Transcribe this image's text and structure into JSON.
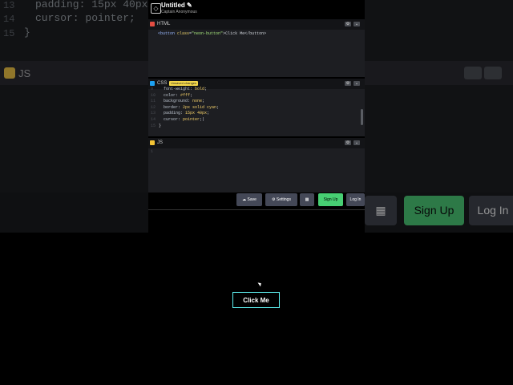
{
  "header": {
    "title": "Untitled",
    "author": "Captain Anonymous",
    "edit_icon": "pencil-icon"
  },
  "html_pane": {
    "label": "HTML",
    "badge_color": "#e44d42",
    "lines": [
      {
        "tag_open": "<button ",
        "attr": "class",
        "eq": "=",
        "str": "\"neon-button\"",
        "text": ">Click Me</button>"
      }
    ]
  },
  "css_pane": {
    "label": "CSS",
    "badge_color": "#1da1f2",
    "warning": "Unsaved changes",
    "lines": [
      {
        "num": "9",
        "prop": "font-weight",
        "val": "bold"
      },
      {
        "num": "10",
        "prop": "color",
        "val": "#fff"
      },
      {
        "num": "11",
        "prop": "background",
        "val": "none"
      },
      {
        "num": "12",
        "prop": "border",
        "val": "2px solid cyan"
      },
      {
        "num": "13",
        "prop": "padding",
        "val": "15px 40px"
      },
      {
        "num": "14",
        "prop": "cursor",
        "val": "pointer"
      },
      {
        "num": "15",
        "close": "}"
      }
    ]
  },
  "js_pane": {
    "label": "JS",
    "badge_color": "#f3c335",
    "first_line": "1"
  },
  "toolbar": {
    "save_label": "Save",
    "settings_label": "Settings",
    "layout_icon": "layout-icon",
    "signup_label": "Sign Up",
    "login_label": "Log In"
  },
  "bg": {
    "line1": "padding: 15px 40px;",
    "line2": "cursor: pointer;",
    "line3": "}",
    "js_label": "JS",
    "signup_label": "Sign Up",
    "login_label": "Log In"
  },
  "preview": {
    "button_label": "Click Me"
  },
  "colors": {
    "accent_green": "#47cf73",
    "neon_cyan": "#5ef0f0"
  }
}
